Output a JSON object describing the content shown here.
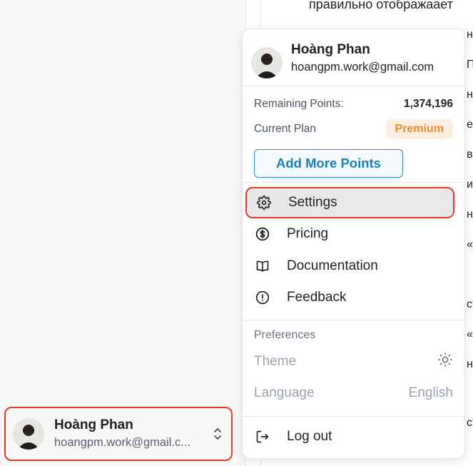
{
  "sidebar": {
    "user": {
      "name": "Hoàng Phan",
      "email": "hoangpm.work@gmail.c..."
    }
  },
  "content": {
    "top_text": "правильно отображаает",
    "fragments": [
      "нь",
      "П",
      "нь",
      "е",
      "ва",
      "и",
      "нь",
      "«",
      "ст",
      "«",
      "нь",
      "ст"
    ]
  },
  "menu": {
    "user": {
      "name": "Hoàng Phan",
      "email": "hoangpm.work@gmail.com"
    },
    "remaining_label": "Remaining Points:",
    "remaining_value": "1,374,196",
    "plan_label": "Current Plan",
    "plan_value": "Premium",
    "add_points": "Add More Points",
    "items": [
      {
        "label": "Settings",
        "icon": "gear-icon"
      },
      {
        "label": "Pricing",
        "icon": "dollar-icon"
      },
      {
        "label": "Documentation",
        "icon": "book-icon"
      },
      {
        "label": "Feedback",
        "icon": "alert-icon"
      }
    ],
    "preferences_title": "Preferences",
    "theme_label": "Theme",
    "language_label": "Language",
    "language_value": "English",
    "logout": "Log out"
  },
  "colors": {
    "accent": "#1a7fb8",
    "premium": "#ee8a2e",
    "highlight": "#e23b2b"
  }
}
